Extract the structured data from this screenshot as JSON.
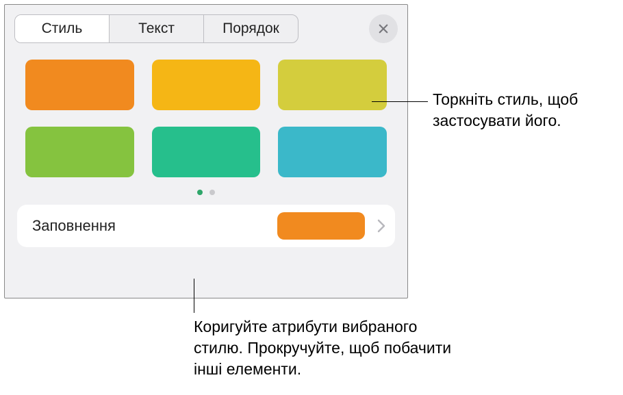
{
  "tabs": {
    "style": "Стиль",
    "text": "Текст",
    "order": "Порядок"
  },
  "swatches": {
    "colors": [
      "#f18a1f",
      "#f5b615",
      "#d4cd3d",
      "#85c33f",
      "#26bf8c",
      "#3bb8c9"
    ]
  },
  "fill": {
    "label": "Заповнення",
    "color": "#f18a1f"
  },
  "callouts": {
    "top": "Торкніть стиль, щоб застосувати його.",
    "bottom": "Коригуйте атрибути вибраного стилю. Прокручуйте, щоб побачити інші елементи."
  }
}
